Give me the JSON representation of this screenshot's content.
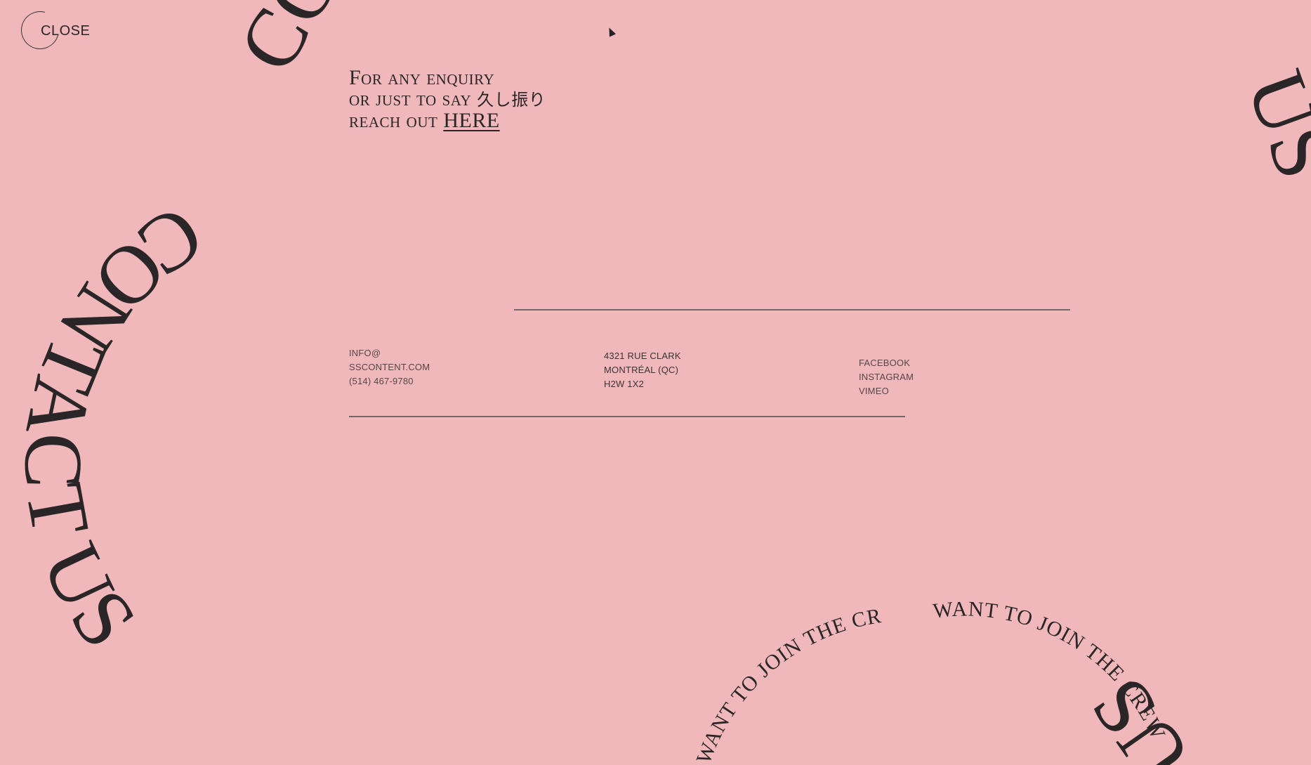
{
  "close": {
    "label": "CLOSE"
  },
  "enquiry": {
    "line1": "For any enquiry",
    "line2_prefix": "or just to say ",
    "line2_jp": "久し振り",
    "line3_prefix": "reach out ",
    "line3_link": "HERE"
  },
  "contact": {
    "email_line1": "INFO@",
    "email_line2": "SSCONTENT.COM",
    "phone": "(514) 467-9780"
  },
  "address": {
    "line1": "4321 RUE CLARK",
    "line2": "MONTRÉAL (QC)",
    "line3": "H2W 1X2"
  },
  "social": {
    "items": [
      "FACEBOOK",
      "INSTAGRAM",
      "VIMEO"
    ]
  },
  "decorative": {
    "contact_us": "CONTACT US",
    "join_crew_left": "WANT TO JOIN THE CREW?",
    "join_crew_right": "WANT TO JOIN THE CREW?",
    "top_left_fragment": "CO",
    "top_right_fragment": "US",
    "bottom_right_fragment": "US"
  },
  "colors": {
    "background": "#f0b8bb",
    "ink": "#2a2526"
  }
}
